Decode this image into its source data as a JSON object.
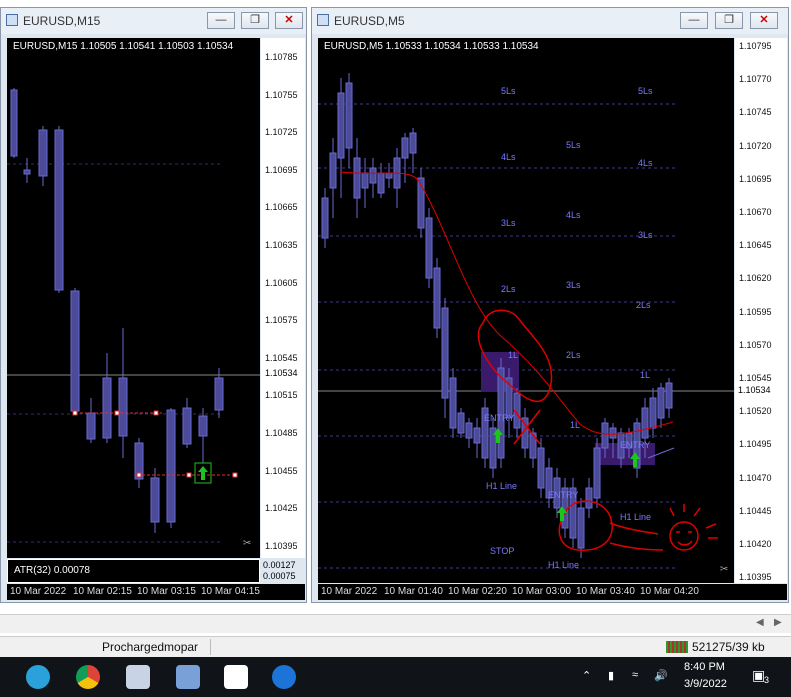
{
  "left_window": {
    "title": "EURUSD,M15",
    "header": "EURUSD,M15  1.10505 1.10541 1.10503 1.10534",
    "indicator_label": "ATR(32) 0.00078",
    "indicator_values": [
      "0.00127",
      "0.00075"
    ],
    "price_labels": [
      "1.10785",
      "1.10755",
      "1.10725",
      "1.10695",
      "1.10665",
      "1.10635",
      "1.10605",
      "1.10575",
      "1.10545",
      "1.10515",
      "1.10485",
      "1.10455",
      "1.10425",
      "1.10395"
    ],
    "current_price": "1.10534",
    "time_labels": [
      "10 Mar 2022",
      "10 Mar 02:15",
      "10 Mar 03:15",
      "10 Mar 04:15"
    ]
  },
  "right_window": {
    "title": "EURUSD,M5",
    "header": "EURUSD,M5  1.10533 1.10534 1.10533 1.10534",
    "price_labels": [
      "1.10795",
      "1.10770",
      "1.10745",
      "1.10720",
      "1.10695",
      "1.10670",
      "1.10645",
      "1.10620",
      "1.10595",
      "1.10570",
      "1.10545",
      "1.10520",
      "1.10495",
      "1.10470",
      "1.10445",
      "1.10420",
      "1.10395"
    ],
    "current_price": "1.10534",
    "time_labels": [
      "10 Mar 2022",
      "10 Mar 01:40",
      "10 Mar 02:20",
      "10 Mar 03:00",
      "10 Mar 03:40",
      "10 Mar 04:20"
    ],
    "levels": [
      "5Ls",
      "5Ls",
      "4Ls",
      "5Ls",
      "4Ls",
      "3Ls",
      "4Ls",
      "3Ls",
      "2Ls",
      "3Ls",
      "2Ls",
      "2Ls",
      "1L",
      "1L",
      "1L"
    ],
    "annotations": [
      "ENTRY",
      "ENTRY",
      "ENTRY",
      "H1 Line",
      "H1 Line",
      "H1 Line",
      "STOP"
    ]
  },
  "status": {
    "profile": "Prochargedmopar",
    "traffic": "521275/39 kb"
  },
  "taskbar": {
    "time": "8:40 PM",
    "date": "3/9/2022",
    "notifications": "3"
  },
  "colors": {
    "chart_bg": "#000000",
    "candle": "#4b4b9a",
    "candle_border": "#6a6ad0",
    "level_line": "#3a3a8a",
    "red_ink": "#e00000",
    "arrow_green": "#1ec41e"
  }
}
